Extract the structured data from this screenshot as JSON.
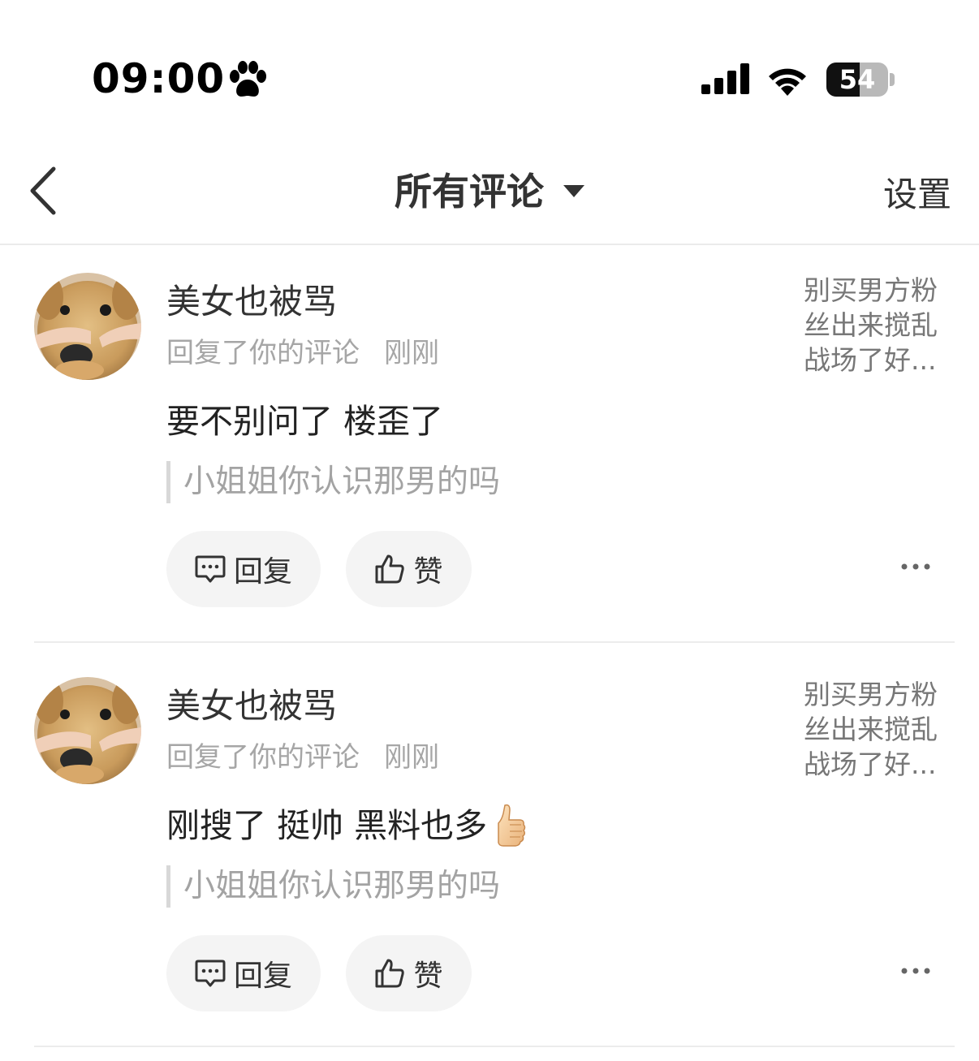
{
  "status_bar": {
    "time": "09:00",
    "battery_level": "54",
    "battery_fraction": 0.54
  },
  "nav": {
    "title": "所有评论",
    "settings_label": "设置"
  },
  "notices": [
    {
      "username": "美女也被骂",
      "action": "回复了你的评论",
      "time": "刚刚",
      "comment": "要不别问了 楼歪了",
      "has_emoji": false,
      "quote": "小姐姐你认识那男的吗",
      "preview": "别买男方粉丝出来搅乱战场了好...",
      "reply_label": "回复",
      "like_label": "赞"
    },
    {
      "username": "美女也被骂",
      "action": "回复了你的评论",
      "time": "刚刚",
      "comment": "刚搜了 挺帅 黑料也多",
      "has_emoji": true,
      "emoji": "thumbs-up-icon",
      "quote": "小姐姐你认识那男的吗",
      "preview": "别买男方粉丝出来搅乱战场了好...",
      "reply_label": "回复",
      "like_label": "赞"
    }
  ]
}
